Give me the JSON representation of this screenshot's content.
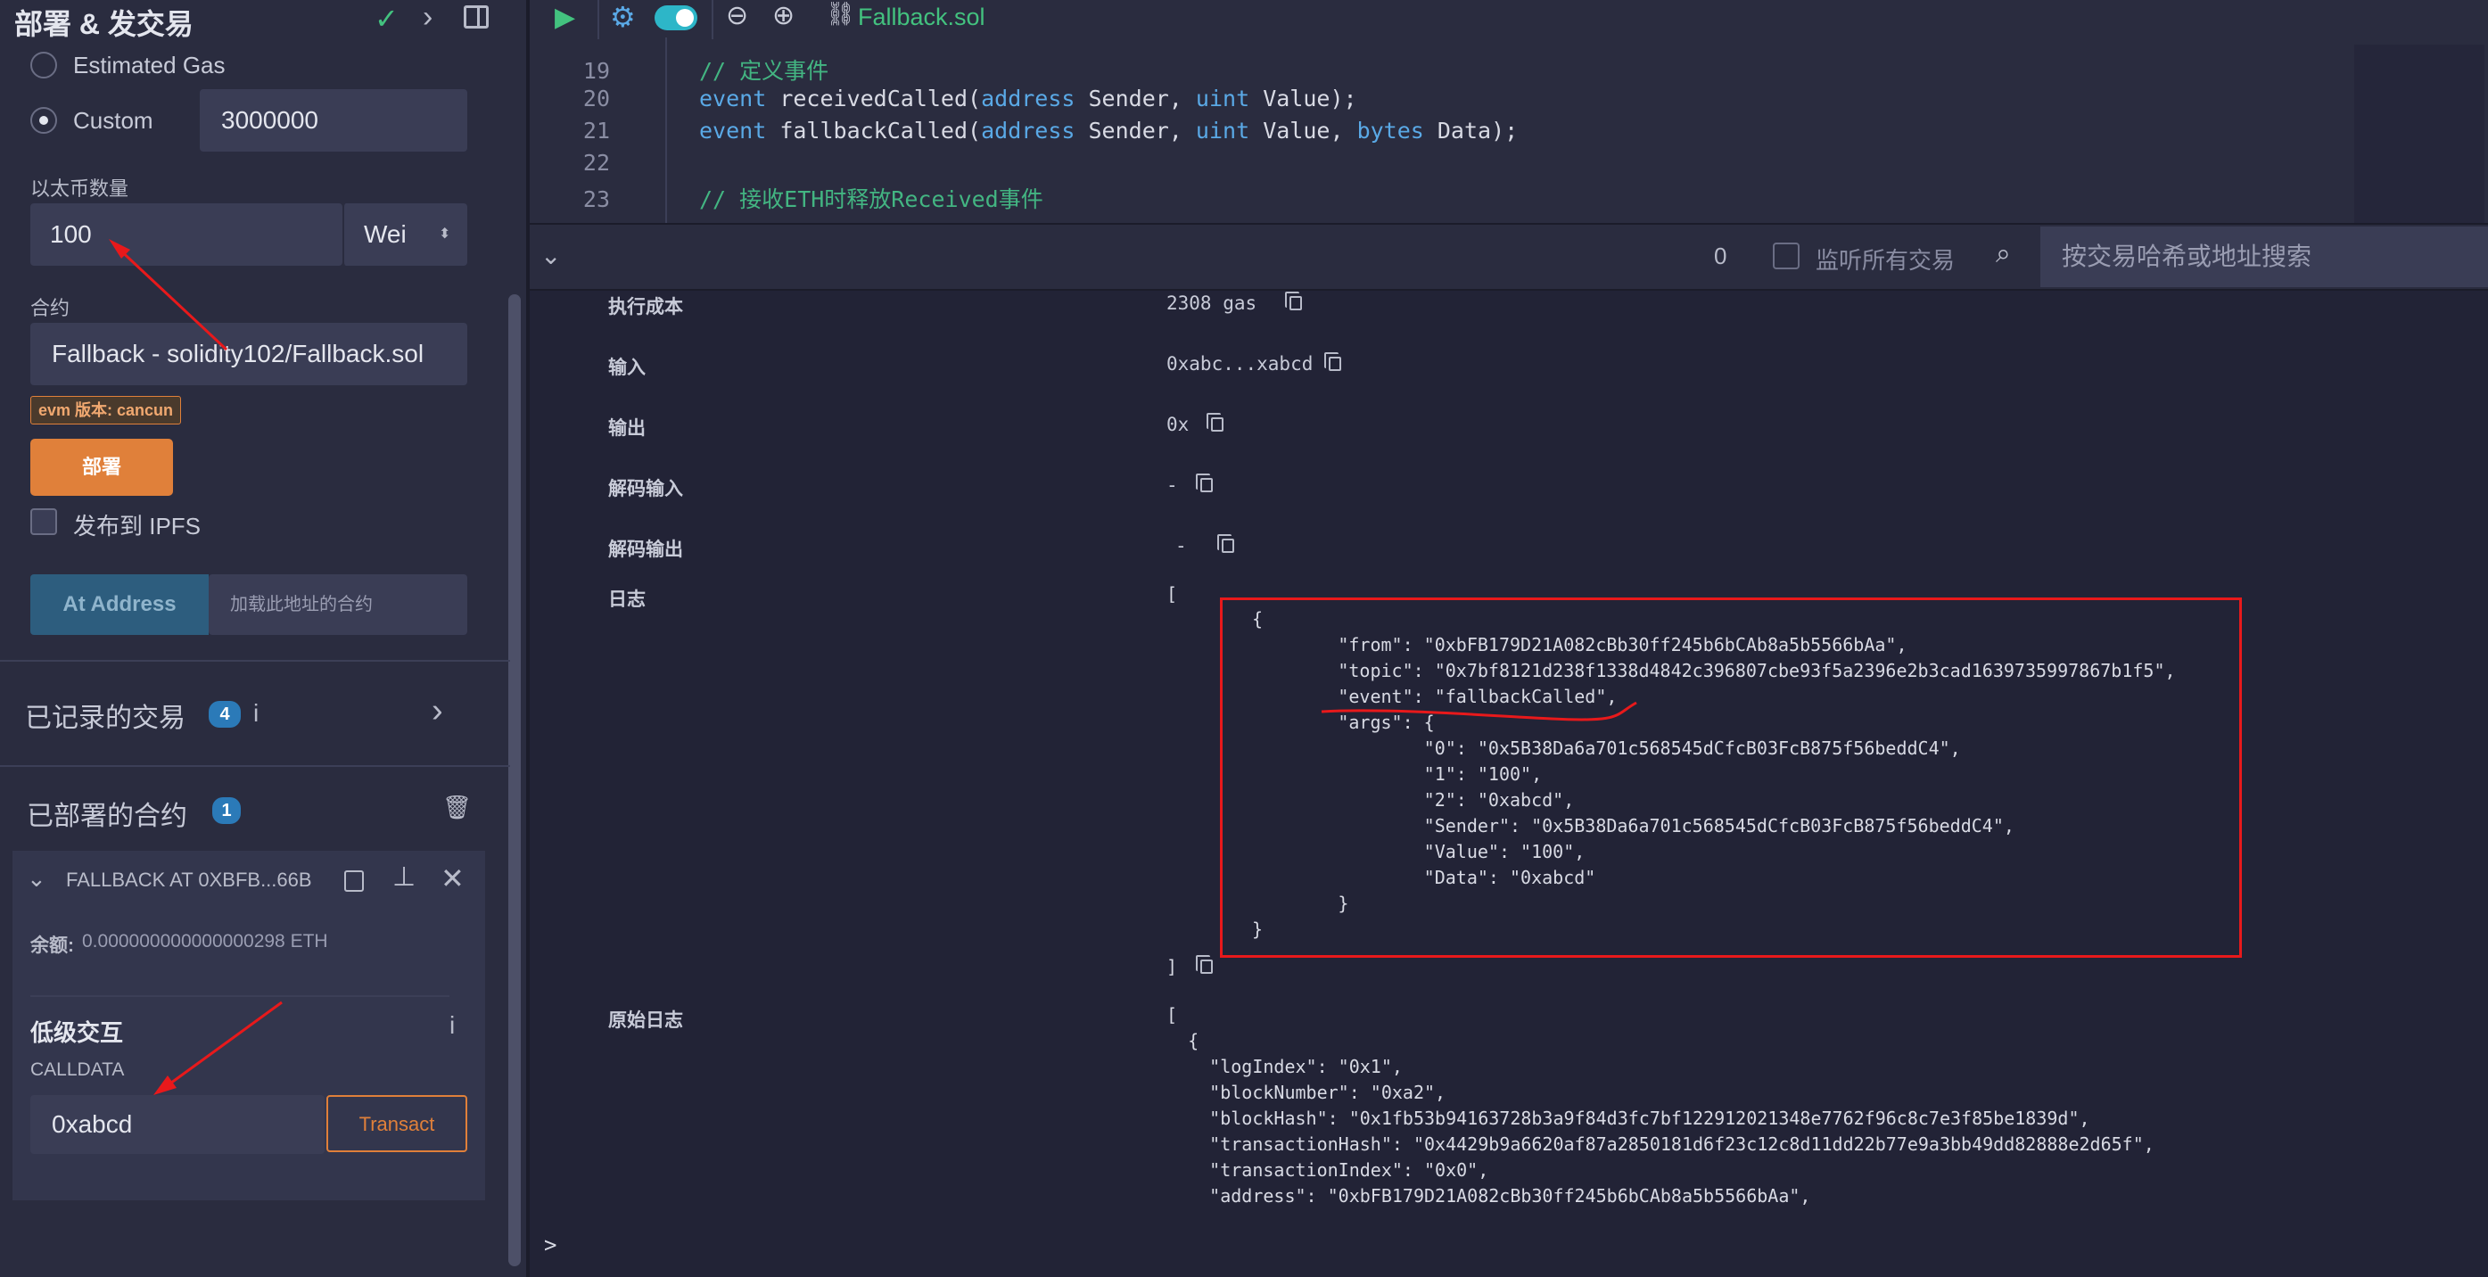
{
  "panel": {
    "title": "部署 & 发交易",
    "gas": {
      "estimated_label": "Estimated Gas",
      "custom_label": "Custom",
      "custom_value": "3000000",
      "selected": "Custom"
    },
    "value_label": "以太币数量",
    "value_amount": "100",
    "value_unit": "Wei",
    "contract_label": "合约",
    "contract_selected": "Fallback - solidity102/Fallback.sol",
    "evm_badge": "evm 版本: cancun",
    "deploy_label": "部署",
    "ipfs_label": "发布到 IPFS",
    "at_address_label": "At Address",
    "at_address_placeholder": "加载此地址的合约",
    "recorded_tx_label": "已记录的交易",
    "recorded_tx_count": "4",
    "deployed_label": "已部署的合约",
    "deployed_count": "1",
    "instance_name": "FALLBACK AT 0XBFB...66B",
    "balance_label": "余额:",
    "balance_value": "0.000000000000000298 ETH",
    "low_level_label": "低级交互",
    "calldata_label": "CALLDATA",
    "calldata_value": "0xabcd",
    "transact_label": "Transact",
    "info_glyph": "i"
  },
  "editor": {
    "tab_name": "Fallback.sol",
    "lines": [
      {
        "num": "19",
        "comment": "// 定义事件"
      },
      {
        "num": "20",
        "kw1": "event",
        "t1": " receivedCalled(",
        "kw2": "address",
        "t2": " Sender, ",
        "kw3": "uint",
        "t3": " Value);"
      },
      {
        "num": "21",
        "kw1": "event",
        "t1": " fallbackCalled(",
        "kw2": "address",
        "t2": " Sender, ",
        "kw3": "uint",
        "t3": " Value, ",
        "kw4": "bytes",
        "t4": " Data);"
      },
      {
        "num": "22"
      },
      {
        "num": "23",
        "comment": "// 接收ETH时释放Received事件"
      }
    ]
  },
  "terminal": {
    "pending_count": "0",
    "listen_label": "监听所有交易",
    "search_placeholder": "按交易哈希或地址搜索",
    "prompt": ">",
    "rows": [
      {
        "label": "执行成本",
        "value": "2308 gas"
      },
      {
        "label": "输入",
        "value": "0xabc...xabcd"
      },
      {
        "label": "输出",
        "value": "0x"
      },
      {
        "label": "解码输入",
        "value": "-"
      },
      {
        "label": "解码输出",
        "value": "-"
      }
    ],
    "logs_label": "日志",
    "logs_open": "[",
    "logs_close": "]",
    "log_lines": [
      "{",
      "        \"from\": \"0xbFB179D21A082cBb30ff245b6bCAb8a5b5566bAa\",",
      "        \"topic\": \"0x7bf8121d238f1338d4842c396807cbe93f5a2396e2b3cad1639735997867b1f5\",",
      "        \"event\": \"fallbackCalled\",",
      "        \"args\": {",
      "                \"0\": \"0x5B38Da6a701c568545dCfcB03FcB875f56beddC4\",",
      "                \"1\": \"100\",",
      "                \"2\": \"0xabcd\",",
      "                \"Sender\": \"0x5B38Da6a701c568545dCfcB03FcB875f56beddC4\",",
      "                \"Value\": \"100\",",
      "                \"Data\": \"0xabcd\"",
      "        }",
      "}"
    ],
    "raw_logs_label": "原始日志",
    "raw_log_lines": [
      "[",
      "  {",
      "    \"logIndex\": \"0x1\",",
      "    \"blockNumber\": \"0xa2\",",
      "    \"blockHash\": \"0x1fb53b94163728b3a9f84d3fc7bf122912021348e7762f96c8c7e3f85be1839d\",",
      "    \"transactionHash\": \"0x4429b9a6620af87a2850181d6f23c12c8d11dd22b77e9a3bb49dd82888e2d65f\",",
      "    \"transactionIndex\": \"0x0\",",
      "    \"address\": \"0xbFB179D21A082cBb30ff245b6bCAb8a5b5566bAa\","
    ]
  },
  "colors": {
    "accent_orange": "#e0803a",
    "annotation_red": "#e8191b",
    "badge_blue": "#2b7ab8",
    "check_green": "#43c27f"
  }
}
